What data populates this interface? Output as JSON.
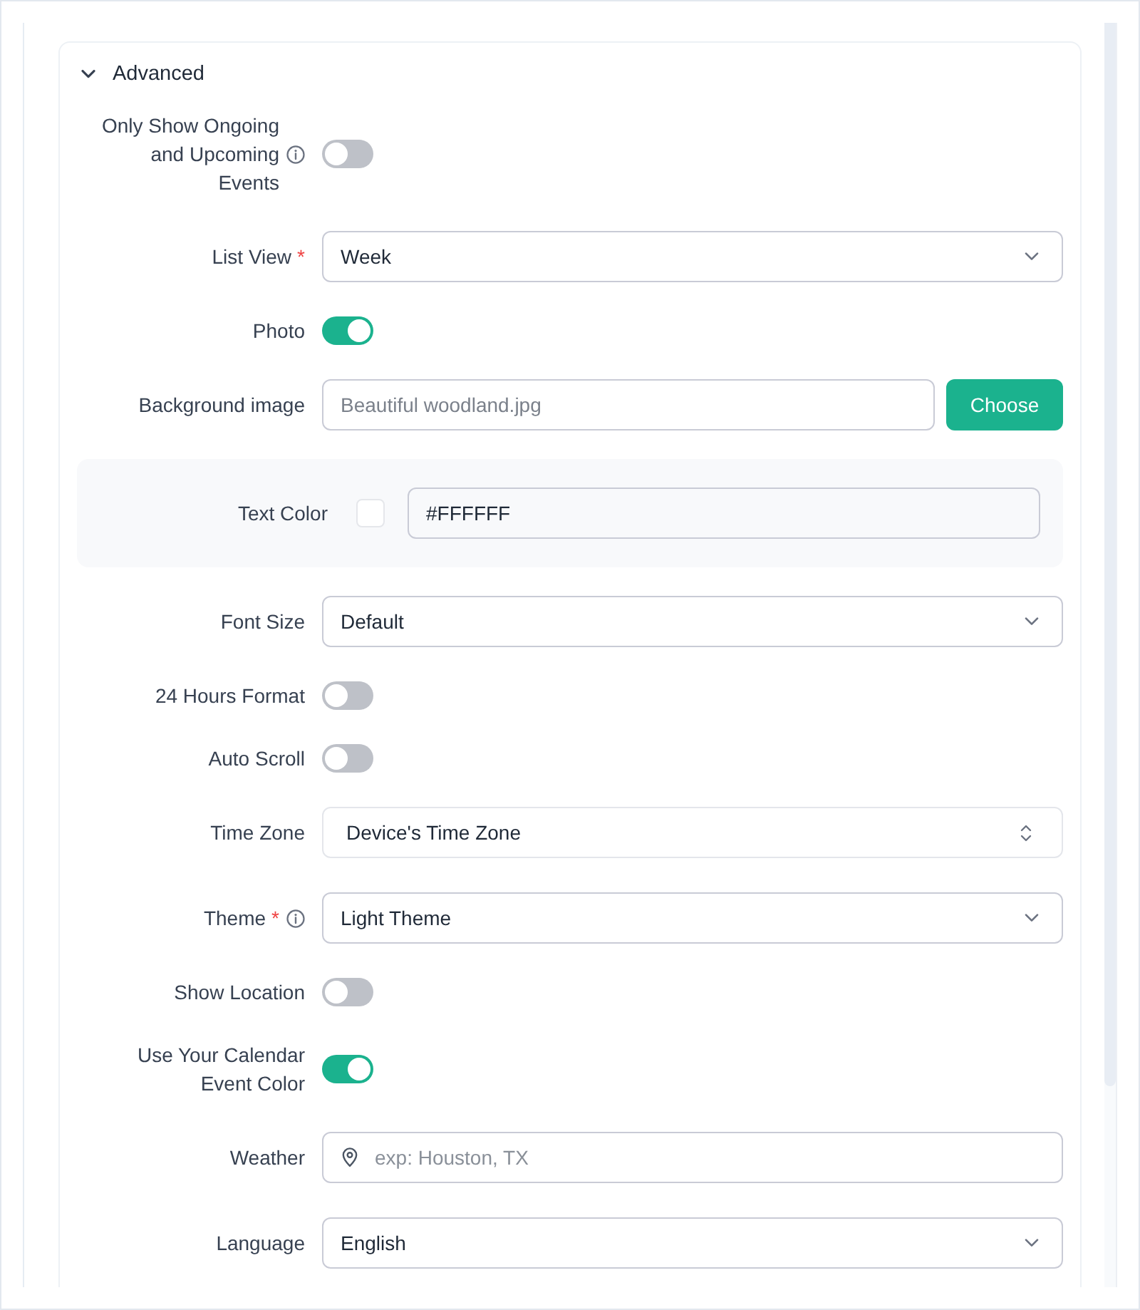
{
  "section": {
    "title": "Advanced",
    "expanded": true
  },
  "fields": [
    {
      "kind": "toggle",
      "label": "Only Show Ongoing and Upcoming Events",
      "info": true,
      "on": false
    },
    {
      "kind": "select",
      "label": "List View",
      "required_mark": "*",
      "value": "Week"
    },
    {
      "kind": "toggle",
      "label": "Photo",
      "on": true
    },
    {
      "kind": "file",
      "label": "Background image",
      "placeholder": "Beautiful woodland.jpg",
      "button": "Choose"
    },
    {
      "kind": "color",
      "label": "Text Color",
      "color": "#ffffff",
      "value": "#FFFFFF"
    },
    {
      "kind": "select",
      "label": "Font Size",
      "value": "Default"
    },
    {
      "kind": "toggle",
      "label": "24 Hours Format",
      "on": false
    },
    {
      "kind": "toggle",
      "label": "Auto Scroll",
      "on": false
    },
    {
      "kind": "native_select",
      "label": "Time Zone",
      "value": "Device's Time Zone"
    },
    {
      "kind": "select",
      "label": "Theme",
      "required_mark": "*",
      "info": true,
      "value": "Light Theme"
    },
    {
      "kind": "toggle",
      "label": "Show Location",
      "on": false
    },
    {
      "kind": "toggle",
      "label": "Use Your Calendar Event Color",
      "on": true
    },
    {
      "kind": "location",
      "label": "Weather",
      "placeholder": "exp: Houston, TX"
    },
    {
      "kind": "select",
      "label": "Language",
      "value": "English"
    }
  ]
}
